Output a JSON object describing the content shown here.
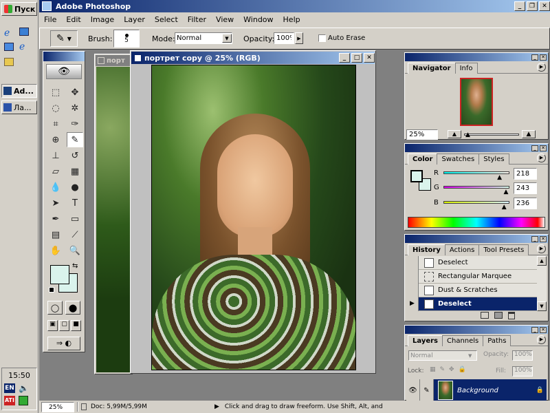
{
  "app": {
    "title": "Adobe Photoshop"
  },
  "taskbar": {
    "start_label": "Пуск",
    "tasks": [
      "Ad...",
      "Ла..."
    ],
    "time": "15:50",
    "lang": "EN"
  },
  "menu": [
    "File",
    "Edit",
    "Image",
    "Layer",
    "Select",
    "Filter",
    "View",
    "Window",
    "Help"
  ],
  "options": {
    "brush_label": "Brush:",
    "brush_size": "5",
    "mode_label": "Mode:",
    "mode_value": "Normal",
    "opacity_label": "Opacity:",
    "opacity_value": "100%",
    "auto_erase_label": "Auto Erase"
  },
  "back_doc": {
    "title": "порт"
  },
  "document": {
    "title": "портрет copy @ 25% (RGB)"
  },
  "navigator": {
    "tabs": [
      "Navigator",
      "Info"
    ],
    "zoom": "25%"
  },
  "color": {
    "tabs": [
      "Color",
      "Swatches",
      "Styles"
    ],
    "r_label": "R",
    "g_label": "G",
    "b_label": "B",
    "r": "218",
    "g": "243",
    "b": "236",
    "r_frac": 0.855,
    "g_frac": 0.953,
    "b_frac": 0.925,
    "foreground": "#daf3ec"
  },
  "history": {
    "tabs": [
      "History",
      "Actions",
      "Tool Presets"
    ],
    "items": [
      "Deselect",
      "Rectangular Marquee",
      "Dust & Scratches",
      "Deselect"
    ]
  },
  "layers": {
    "tabs": [
      "Layers",
      "Channels",
      "Paths"
    ],
    "mode": "Normal",
    "opacity_label": "Opacity:",
    "opacity": "100%",
    "lock_label": "Lock:",
    "fill_label": "Fill:",
    "fill": "100%",
    "layer_name": "Background"
  },
  "status": {
    "zoom": "25%",
    "doc": "Doc: 5,99M/5,99M",
    "hint": "Click and drag to draw freeform.  Use Shift, Alt, and"
  }
}
